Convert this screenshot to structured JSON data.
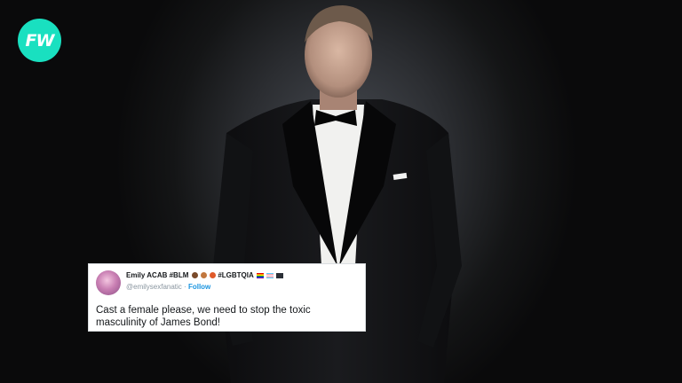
{
  "brand": {
    "logo_text": "FW",
    "logo_color": "#19e0c0",
    "logo_icon": "fw-logo-icon"
  },
  "photo": {
    "subject": "man in black tuxedo with bow tie"
  },
  "tweet": {
    "display_name": "Emily ACAB #BLM",
    "name_tag": "#LGBTQIA",
    "handle": "@emilysexfanatic",
    "separator": "·",
    "follow_label": "Follow",
    "text": "Cast a female please, we need to stop the toxic masculinity of James Bond!",
    "accent_color": "#1b95e0"
  }
}
